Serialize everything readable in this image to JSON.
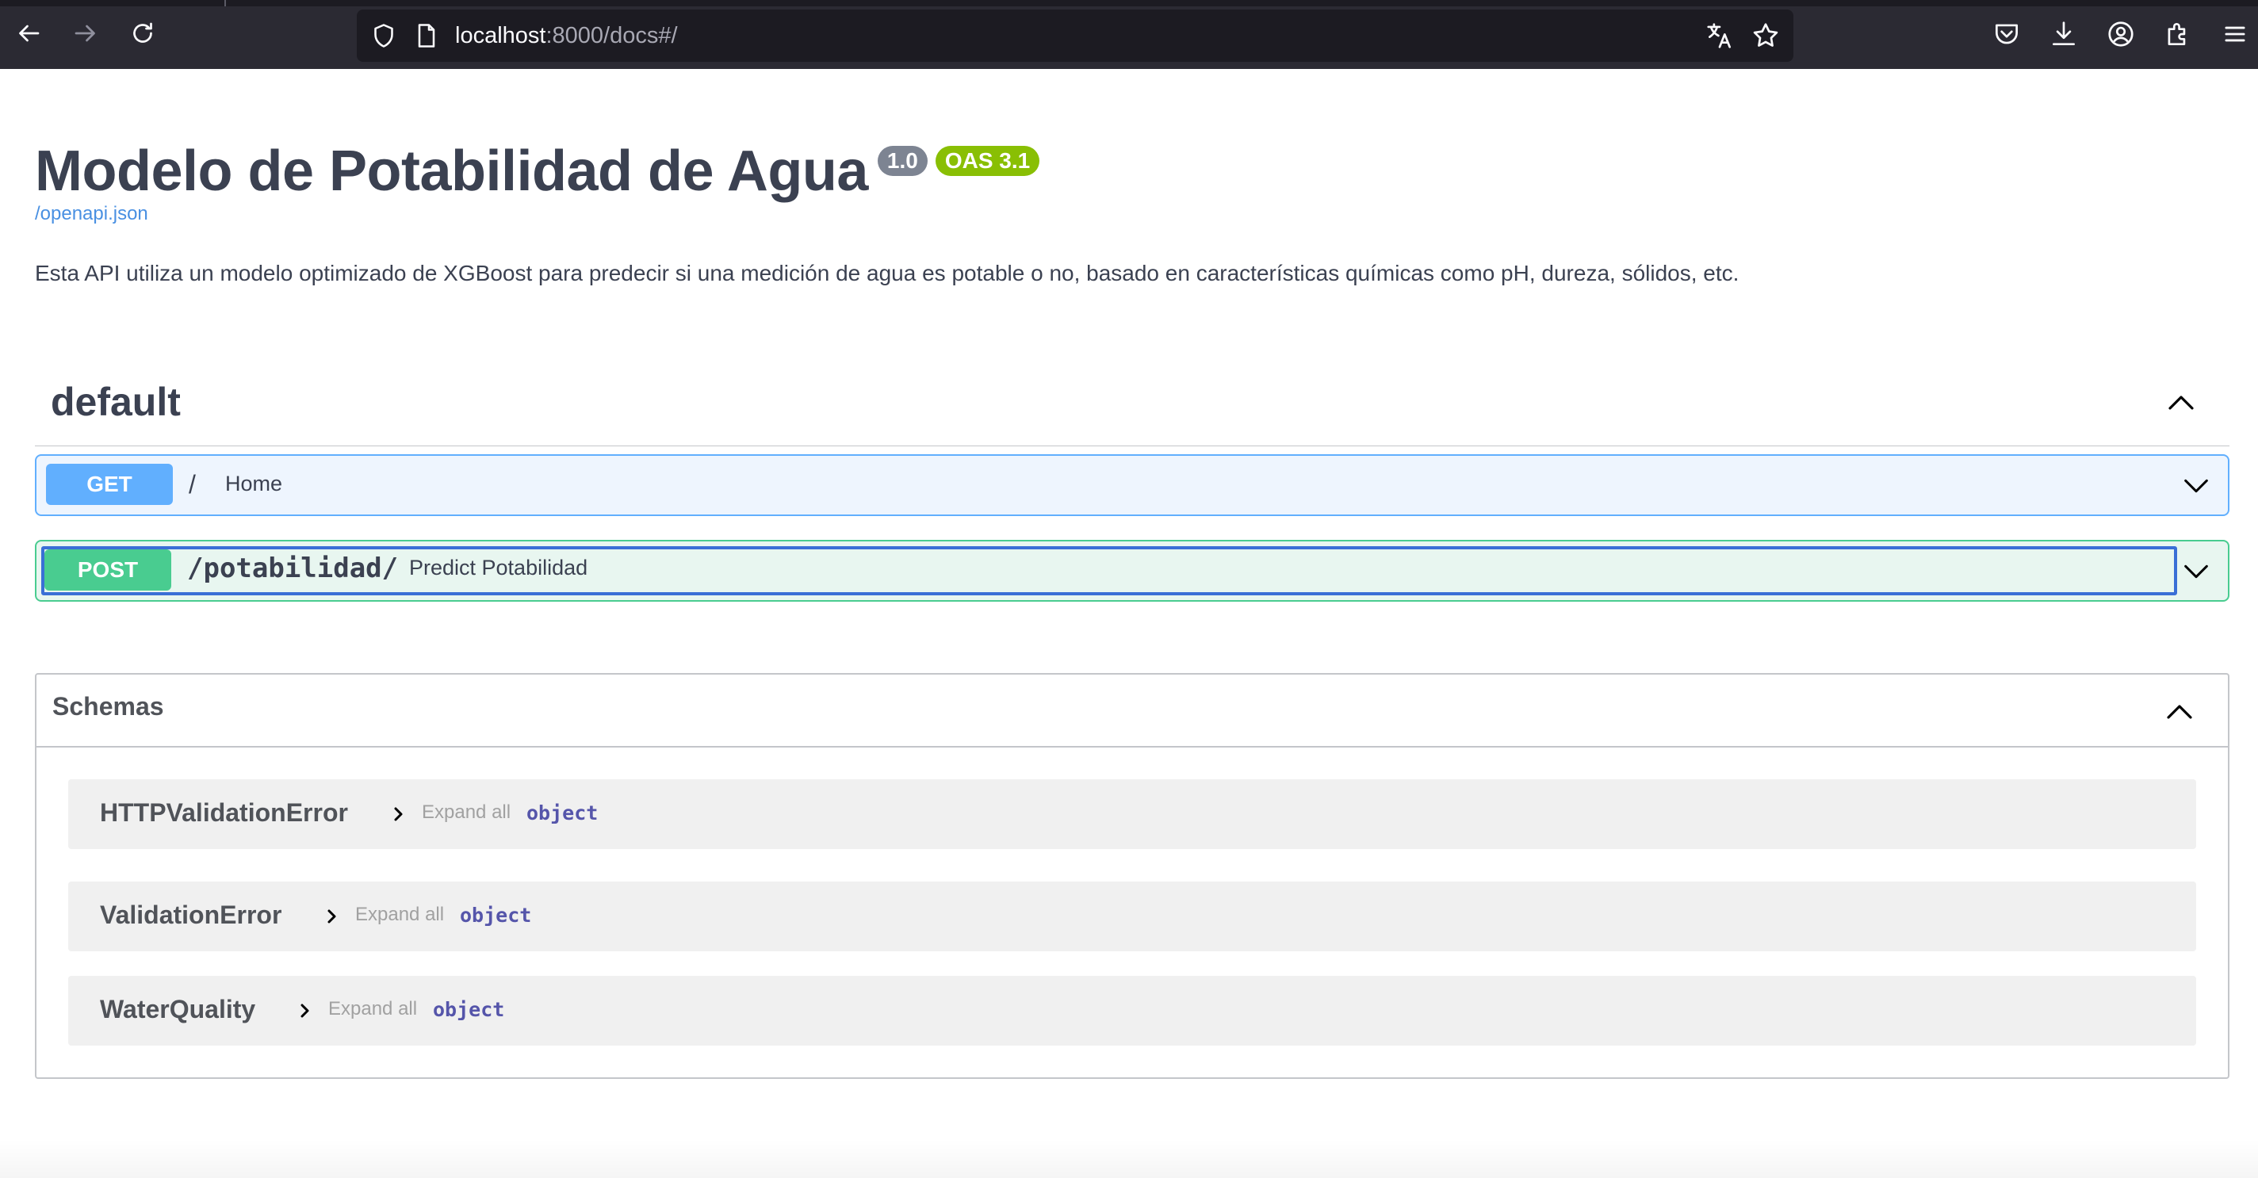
{
  "browser": {
    "url_host": "localhost",
    "url_rest": ":8000/docs#/"
  },
  "info": {
    "title": "Modelo de Potabilidad de Agua",
    "version": "1.0",
    "oas": "OAS 3.1",
    "spec_link": "/openapi.json",
    "description": "Esta API utiliza un modelo optimizado de XGBoost para predecir si una medición de agua es potable o no, basado en características químicas como pH, dureza, sólidos, etc."
  },
  "tag": {
    "name": "default"
  },
  "operations": [
    {
      "method": "GET",
      "path": "/",
      "summary": "Home"
    },
    {
      "method": "POST",
      "path": "/potabilidad/",
      "summary": "Predict Potabilidad"
    }
  ],
  "schemas": {
    "title": "Schemas",
    "items": [
      {
        "name": "HTTPValidationError",
        "expand": "Expand all",
        "type": "object"
      },
      {
        "name": "ValidationError",
        "expand": "Expand all",
        "type": "object"
      },
      {
        "name": "WaterQuality",
        "expand": "Expand all",
        "type": "object"
      }
    ]
  },
  "colors": {
    "get": "#61affe",
    "post": "#49cc90",
    "link": "#4990e2",
    "oas_badge": "#89bf04"
  }
}
